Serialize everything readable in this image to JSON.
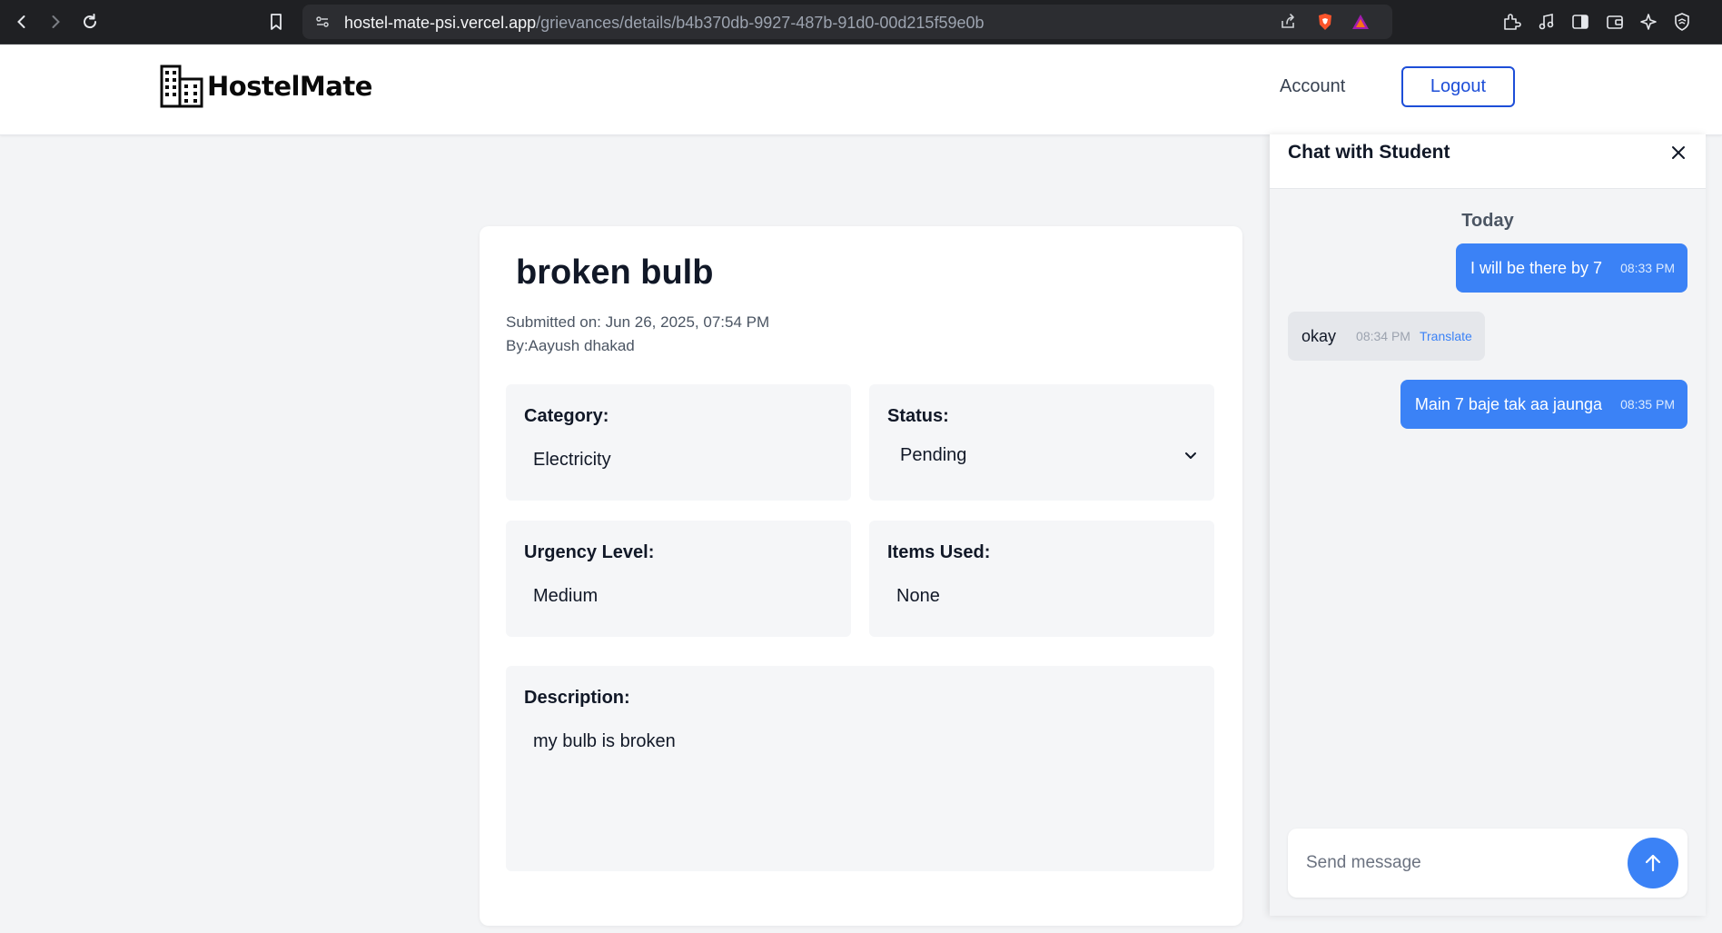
{
  "browser": {
    "url_host": "hostel-mate-psi.vercel.app",
    "url_path": "/grievances/details/b4b370db-9927-487b-91d0-00d215f59e0b"
  },
  "header": {
    "logo_text": "HostelMate",
    "account_label": "Account",
    "logout_label": "Logout"
  },
  "grievance": {
    "title": "broken bulb",
    "submitted": "Submitted on: Jun 26, 2025, 07:54 PM",
    "by": "By:Aayush dhakad",
    "category_label": "Category:",
    "category_value": "Electricity",
    "status_label": "Status:",
    "status_value": "Pending",
    "urgency_label": "Urgency Level:",
    "urgency_value": "Medium",
    "items_label": "Items Used:",
    "items_value": "None",
    "description_label": "Description:",
    "description_value": "my bulb is broken"
  },
  "chat": {
    "title": "Chat with Student",
    "day_label": "Today",
    "messages": [
      {
        "text": "I will be there by 7",
        "time": "08:33 PM",
        "direction": "out"
      },
      {
        "text": "okay",
        "time": "08:34 PM",
        "direction": "in",
        "action": "Translate"
      },
      {
        "text": "Main 7 baje tak aa jaunga",
        "time": "08:35 PM",
        "direction": "out"
      }
    ],
    "input_placeholder": "Send message"
  },
  "colors": {
    "accent": "#3b82f6",
    "logout_border": "#1d4ed8",
    "page_bg": "#f3f4f6"
  }
}
